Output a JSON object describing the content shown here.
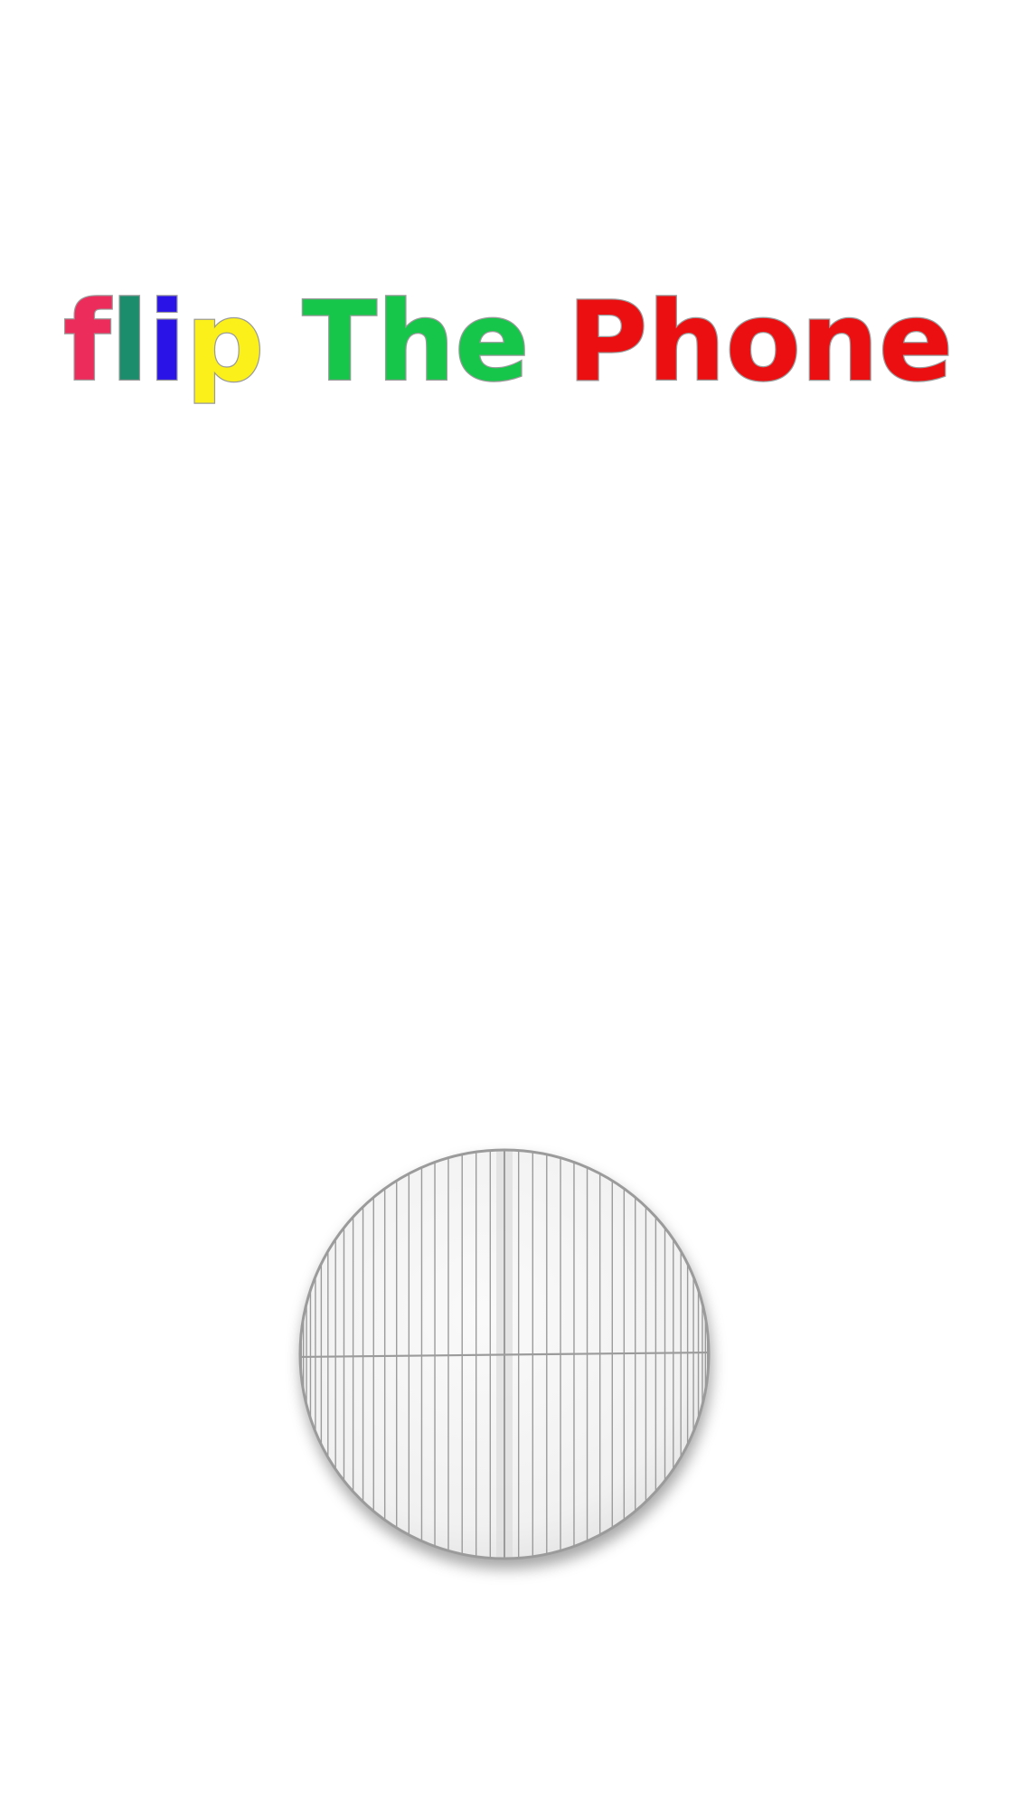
{
  "title": {
    "words": [
      {
        "letters": [
          {
            "char": "f",
            "color": "#ec2d5c"
          },
          {
            "char": "l",
            "color": "#1b8c6c"
          },
          {
            "char": "i",
            "color": "#2a13e6"
          },
          {
            "char": "p",
            "color": "#fbf01a"
          }
        ]
      },
      {
        "letters": [
          {
            "char": "T",
            "color": "#15c64b"
          },
          {
            "char": "h",
            "color": "#15c64b"
          },
          {
            "char": "e",
            "color": "#15c64b"
          }
        ]
      },
      {
        "letters": [
          {
            "char": "P",
            "color": "#ec0f12"
          },
          {
            "char": "h",
            "color": "#ec0f12"
          },
          {
            "char": "o",
            "color": "#ec0f12"
          },
          {
            "char": "n",
            "color": "#ec0f12"
          },
          {
            "char": "e",
            "color": "#ec0f12"
          }
        ]
      }
    ],
    "outline_color": "#9a9a9a"
  },
  "ball": {
    "fill": "#f1f1f1",
    "line_color": "#9b9b9b",
    "highlight": "#dcdcdc"
  }
}
